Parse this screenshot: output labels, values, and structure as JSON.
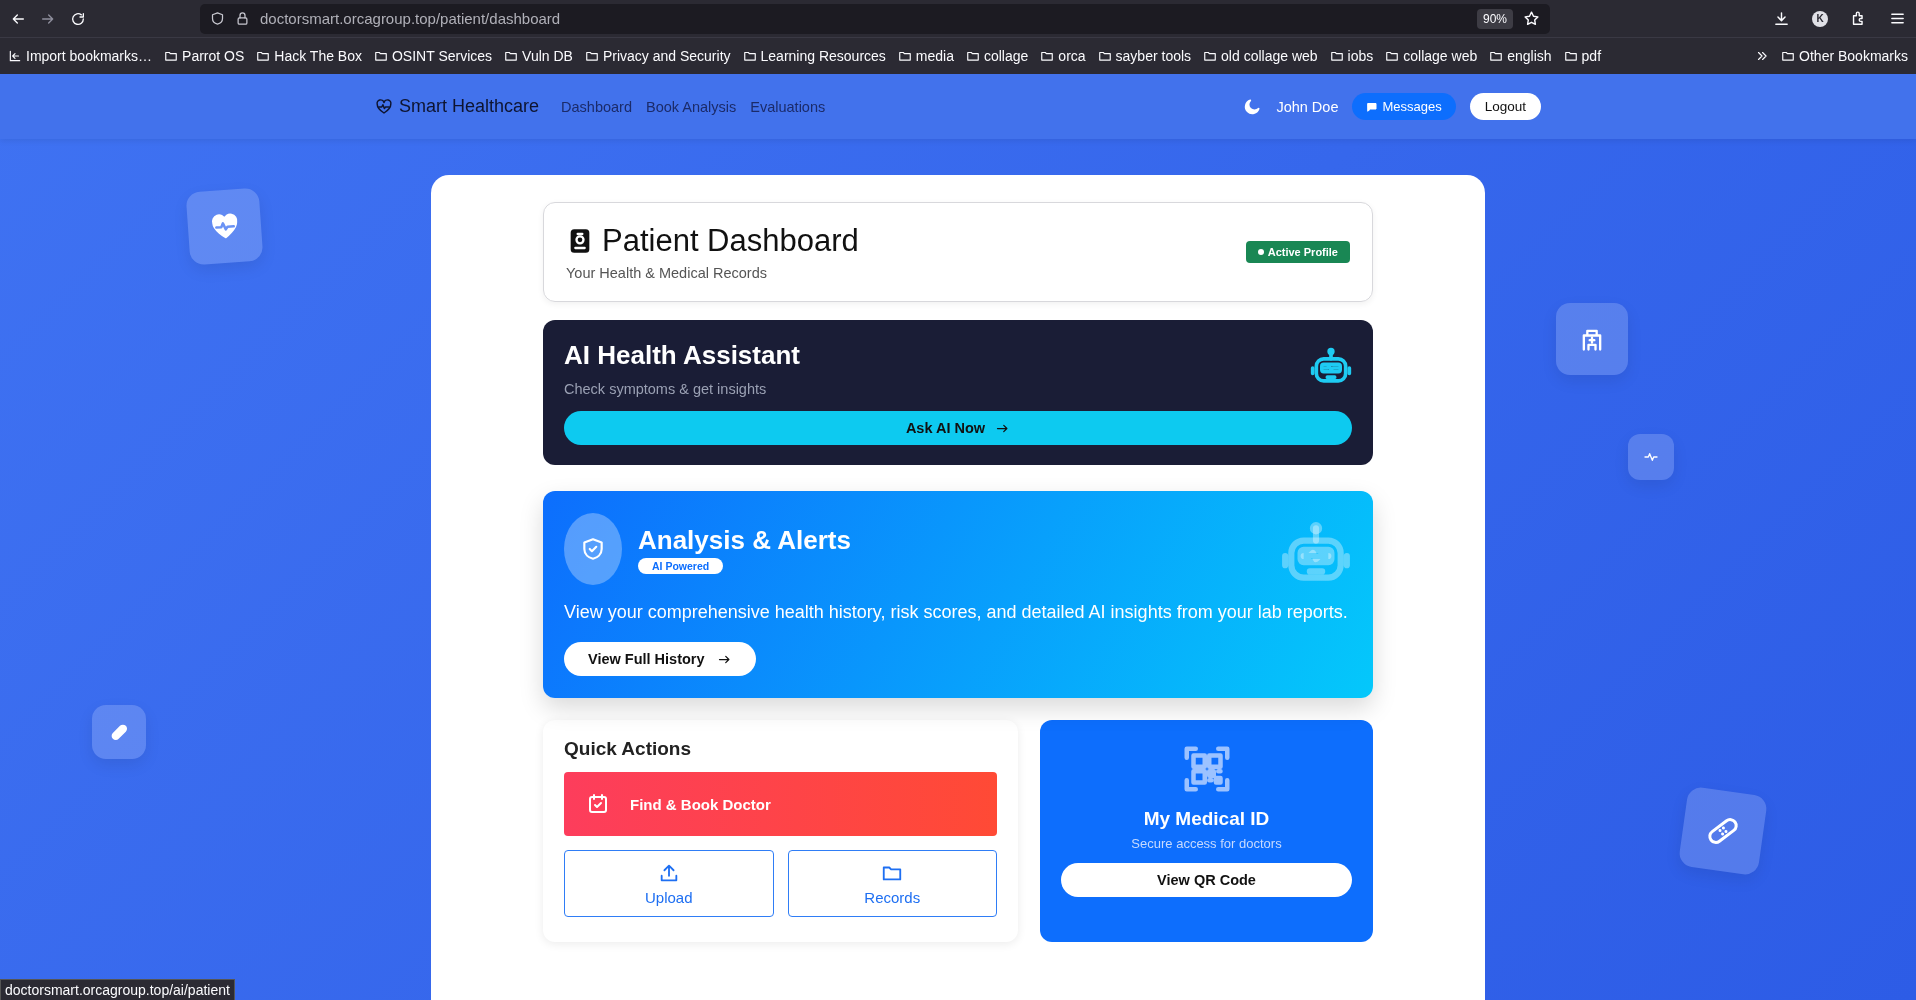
{
  "browser": {
    "url": "doctorsmart.orcagroup.top/patient/dashboard",
    "zoom": "90%",
    "account_initial": "K",
    "bookmarks": [
      {
        "kind": "import",
        "label": "Import bookmarks…"
      },
      {
        "kind": "folder",
        "label": "Parrot OS"
      },
      {
        "kind": "folder",
        "label": "Hack The Box"
      },
      {
        "kind": "folder",
        "label": "OSINT Services"
      },
      {
        "kind": "folder",
        "label": "Vuln DB"
      },
      {
        "kind": "folder",
        "label": "Privacy and Security"
      },
      {
        "kind": "folder",
        "label": "Learning Resources"
      },
      {
        "kind": "folder",
        "label": "media"
      },
      {
        "kind": "folder",
        "label": "collage"
      },
      {
        "kind": "folder",
        "label": "orca"
      },
      {
        "kind": "folder",
        "label": "sayber tools"
      },
      {
        "kind": "folder",
        "label": "old collage web"
      },
      {
        "kind": "folder",
        "label": "iobs"
      },
      {
        "kind": "folder",
        "label": "collage web"
      },
      {
        "kind": "folder",
        "label": "english"
      },
      {
        "kind": "folder",
        "label": "pdf"
      }
    ],
    "other_bookmarks": "Other Bookmarks",
    "status_url": "doctorsmart.orcagroup.top/ai/patient"
  },
  "nav": {
    "brand": "Smart Healthcare",
    "links": [
      "Dashboard",
      "Book Analysis",
      "Evaluations"
    ],
    "user": "John Doe",
    "messages": "Messages",
    "logout": "Logout"
  },
  "header": {
    "title": "Patient Dashboard",
    "subtitle": "Your Health & Medical Records",
    "badge": "Active Profile"
  },
  "assistant": {
    "title": "AI Health Assistant",
    "subtitle": "Check symptoms & get insights",
    "button": "Ask AI Now"
  },
  "analysis": {
    "title": "Analysis & Alerts",
    "badge": "AI Powered",
    "text": "View your comprehensive health history, risk scores, and detailed AI insights from your lab reports.",
    "button": "View Full History"
  },
  "quick_actions": {
    "title": "Quick Actions",
    "primary": "Find & Book Doctor",
    "actions": [
      {
        "kind": "upload",
        "label": "Upload"
      },
      {
        "kind": "records",
        "label": "Records"
      }
    ]
  },
  "medical_id": {
    "title": "My Medical ID",
    "subtitle": "Secure access for doctors",
    "button": "View QR Code"
  }
}
